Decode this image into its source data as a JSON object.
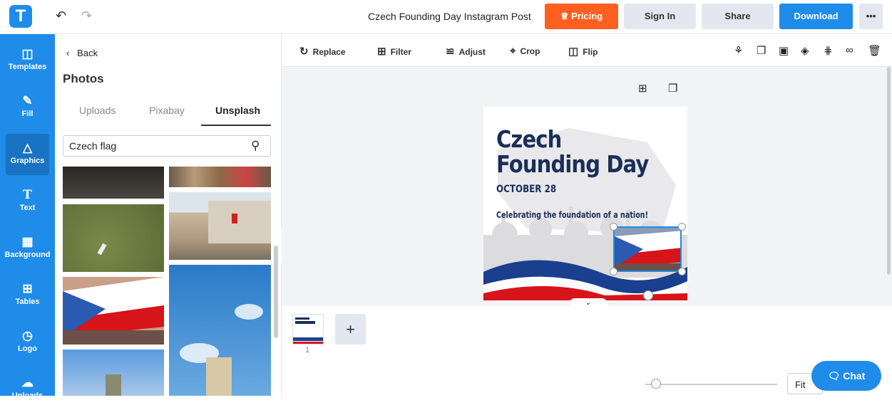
{
  "app": {
    "logo_letter": "T",
    "doc_title": "Czech Founding Day Instagram Post"
  },
  "header": {
    "pricing": "Pricing",
    "sign_in": "Sign In",
    "share": "Share",
    "download": "Download",
    "more": "•••"
  },
  "rail": [
    {
      "label": "Templates",
      "icon": "templates-icon"
    },
    {
      "label": "Fill",
      "icon": "pencil-icon"
    },
    {
      "label": "Graphics",
      "icon": "shapes-icon"
    },
    {
      "label": "Text",
      "icon": "text-icon"
    },
    {
      "label": "Background",
      "icon": "background-icon"
    },
    {
      "label": "Tables",
      "icon": "table-icon"
    },
    {
      "label": "Logo",
      "icon": "logo-icon"
    },
    {
      "label": "Uploads",
      "icon": "upload-icon"
    }
  ],
  "panel": {
    "back": "Back",
    "title": "Photos",
    "tabs": [
      "Uploads",
      "Pixabay",
      "Unsplash"
    ],
    "search_value": "Czech flag"
  },
  "toolbar": {
    "replace": "Replace",
    "filter": "Filter",
    "adjust": "Adjust",
    "crop": "Crop",
    "flip": "Flip"
  },
  "card": {
    "title1": "Czech",
    "title2": "Founding Day",
    "date": "OCTOBER 28",
    "subtitle": "Celebrating the foundation of a nation!"
  },
  "pages": {
    "page_number": "1",
    "add": "+"
  },
  "zoom": {
    "fit": "Fit"
  },
  "chat": {
    "label": "Chat"
  },
  "colors": {
    "accent": "#1e8ce8",
    "pricing": "#ff5f1f",
    "navy": "#1a2f58",
    "red": "#d7141a"
  }
}
